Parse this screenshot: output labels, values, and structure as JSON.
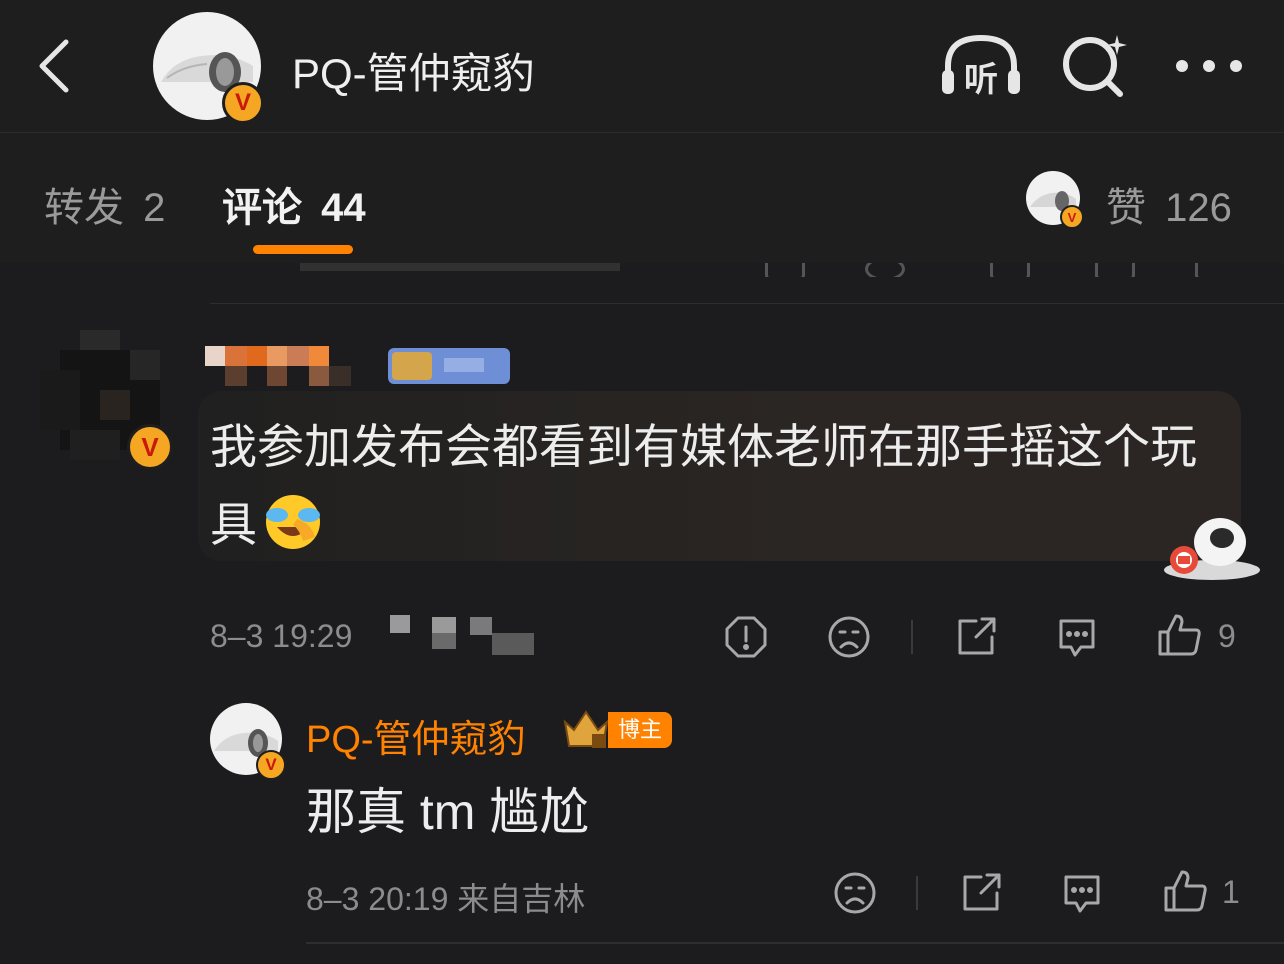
{
  "header": {
    "title": "PQ-管仲窥豹",
    "listen_label": "听"
  },
  "tabs": {
    "repost_label": "转发",
    "repost_count": "2",
    "comments_label": "评论",
    "comments_count": "44",
    "likes_label": "赞",
    "likes_count": "126"
  },
  "comments": [
    {
      "username": "",
      "text": "我参加发布会都看到有媒体老师在那手摇这个玩具",
      "emoji": "laughing-crying-emoji",
      "time": "8–3 19:29",
      "like_count": "9"
    }
  ],
  "reply": {
    "username": "PQ-管仲窥豹",
    "badge_label": "博主",
    "text": "那真 tm 尴尬",
    "time_location": "8–3 20:19 来自吉林",
    "like_count": "1"
  },
  "colors": {
    "background": "#1c1c1e",
    "accent_orange": "#ff8200",
    "verified_badge": "#f5a623",
    "bubble": "#2b2623"
  }
}
